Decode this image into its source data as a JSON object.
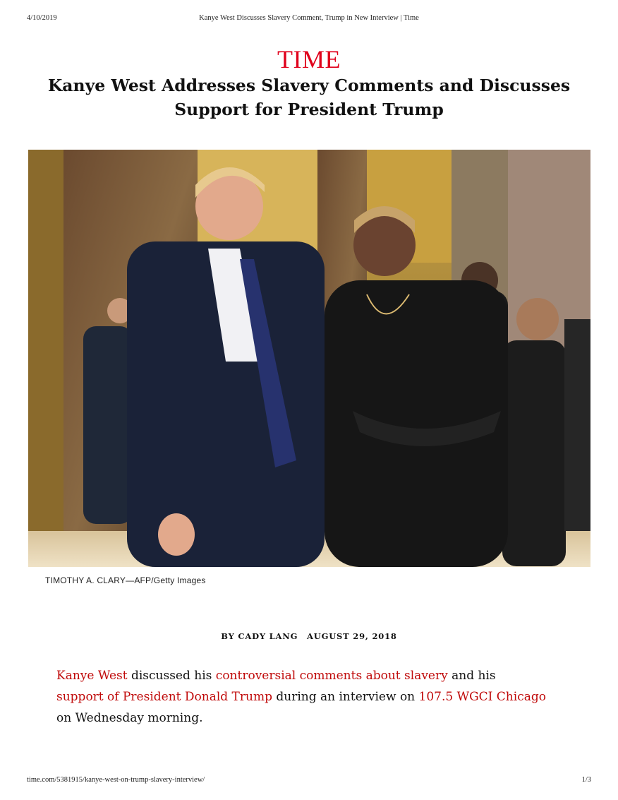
{
  "print_header": {
    "date": "4/10/2019",
    "title": "Kanye West Discusses Slavery Comment, Trump in New Interview | Time"
  },
  "logo": {
    "text": "TIME",
    "color": "#e0001b"
  },
  "headline": {
    "line1": "Kanye West Addresses Slavery Comments and Discusses",
    "line2": "Support for President Trump"
  },
  "photo": {
    "caption": "TIMOTHY A. CLARY—AFP/Getty Images"
  },
  "byline": {
    "author": "BY CADY LANG",
    "date": "AUGUST 29, 2018"
  },
  "paragraph": {
    "link1": "Kanye West",
    "text1": " discussed his ",
    "link2": "controversial comments about slavery",
    "text2": " and his ",
    "link3": "support of President Donald Trump",
    "text3": " during an interview on ",
    "link4": "107.5 WGCI Chicago",
    "text4": " on Wednesday morning."
  },
  "print_footer": {
    "url": "time.com/5381915/kanye-west-on-trump-slavery-interview/",
    "page": "1/3"
  },
  "colors": {
    "link": "#c00a0a",
    "logo": "#e0001b"
  }
}
